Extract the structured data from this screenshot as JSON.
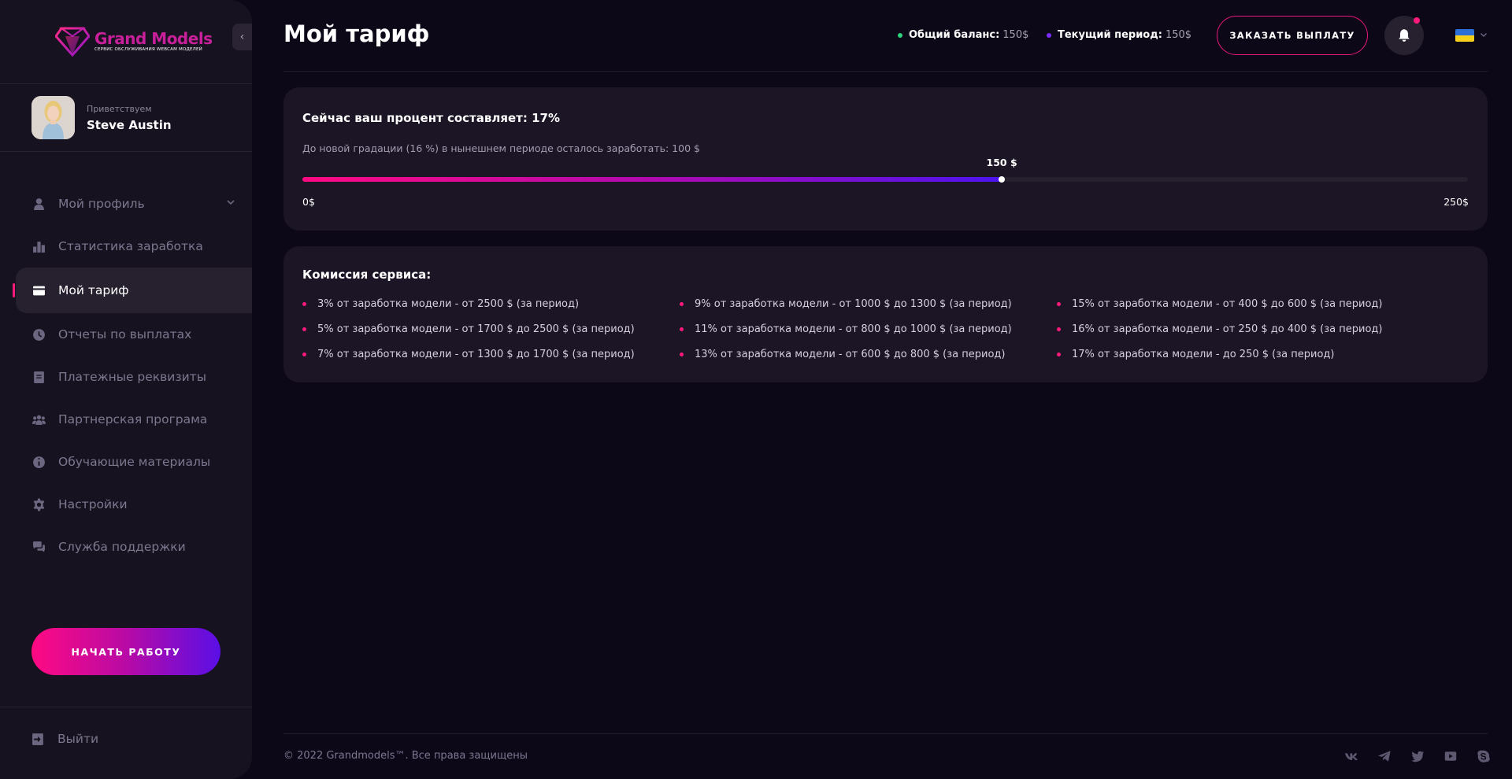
{
  "brand": {
    "name": "Grand Models",
    "tagline": "СЕРВИС ОБСЛУЖИВАНИЯ WEBCAM МОДЕЛЕЙ",
    "color": "#c8209a"
  },
  "user": {
    "greeting": "Приветствуем",
    "name": "Steve Austin"
  },
  "sidebar": {
    "items": [
      {
        "label": "Мой профиль",
        "icon": "user-icon"
      },
      {
        "label": "Статистика заработка",
        "icon": "bar-chart-icon"
      },
      {
        "label": "Мой тариф",
        "icon": "credit-card-icon",
        "active": true
      },
      {
        "label": "Отчеты по выплатах",
        "icon": "clock-icon"
      },
      {
        "label": "Платежные реквизиты",
        "icon": "document-icon"
      },
      {
        "label": "Партнерская програма",
        "icon": "users-icon"
      },
      {
        "label": "Обучающие материалы",
        "icon": "info-icon"
      },
      {
        "label": "Настройки",
        "icon": "gear-icon"
      },
      {
        "label": "Служба поддержки",
        "icon": "chat-icon"
      }
    ],
    "start_button": "НАЧАТЬ РАБОТУ",
    "logout": "Выйти"
  },
  "header": {
    "title": "Мой тариф",
    "balance_label": "Общий баланс:",
    "balance_value": "150$",
    "period_label": "Текущий период:",
    "period_value": "150$",
    "payout_button": "ЗАКАЗАТЬ ВЫПЛАТУ",
    "language": "ukraine-flag-icon"
  },
  "tariff": {
    "title": "Сейчас ваш процент составляет: 17%",
    "subtitle": "До новой градации (16 %) в нынешнем периоде осталось заработать: 100 $",
    "current_label": "150 $",
    "current_value": 150,
    "min_label": "0$",
    "max_label": "250$",
    "min": 0,
    "max": 250
  },
  "commission": {
    "title": "Комиссия сервиса:",
    "items": [
      "3% от заработка модели - от 2500 $ (за период)",
      "9% от заработка модели - от 1000 $ до 1300 $ (за период)",
      "15% от заработка модели - от 400 $ до 600 $ (за период)",
      "5% от заработка модели - от 1700 $ до 2500 $ (за период)",
      "11% от заработка модели - от 800 $ до 1000 $ (за период)",
      "16% от заработка модели - от 250 $ до 400 $ (за период)",
      "7% от заработка модели - от 1300 $ до 1700 $ (за период)",
      "13% от заработка модели - от 600 $ до 800 $ (за период)",
      "17% от заработка модели - до 250 $ (за период)"
    ]
  },
  "footer": {
    "copyright": "© 2022 Grandmodels™. Все права защищены",
    "socials": [
      "vk-icon",
      "telegram-icon",
      "twitter-icon",
      "youtube-icon",
      "skype-icon"
    ]
  },
  "colors": {
    "accent_pink": "#ff1a7c",
    "accent_purple": "#5a0fe6",
    "balance_dot": "#2bd37a",
    "period_dot": "#7a2cff"
  }
}
